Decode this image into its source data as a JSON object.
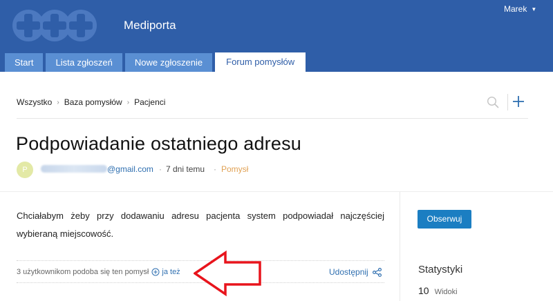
{
  "header": {
    "brand": "Mediporta",
    "user": "Marek",
    "colors": {
      "header_bg": "#2f5ea8",
      "tab_bg": "#5a8fd3"
    },
    "tabs": [
      {
        "label": "Start",
        "active": false
      },
      {
        "label": "Lista zgłoszeń",
        "active": false
      },
      {
        "label": "Nowe zgłoszenie",
        "active": false
      },
      {
        "label": "Forum pomysłów",
        "active": true
      }
    ]
  },
  "breadcrumb": {
    "items": [
      "Wszystko",
      "Baza pomysłów",
      "Pacjenci"
    ],
    "icons": {
      "search": "search-icon",
      "add": "plus-icon"
    }
  },
  "post": {
    "title": "Podpowiadanie ostatniego adresu",
    "author": {
      "avatar_letter": "P",
      "email_suffix": "@gmail.com"
    },
    "date": "7 dni temu",
    "category": "Pomysł",
    "category_color": "#e0a154",
    "body": "Chciałabym żeby przy dodawaniu adresu pacjenta system podpowiadał najczęściej wybieraną miejscowość.",
    "likes_text": "3 użytkownikom podoba się ten pomysł",
    "metoo_label": "ja też",
    "share_label": "Udostępnij"
  },
  "sidebar": {
    "follow_label": "Obserwuj",
    "stats_title": "Statystyki",
    "stats": [
      {
        "value": "10",
        "label": "Widoki"
      }
    ]
  }
}
